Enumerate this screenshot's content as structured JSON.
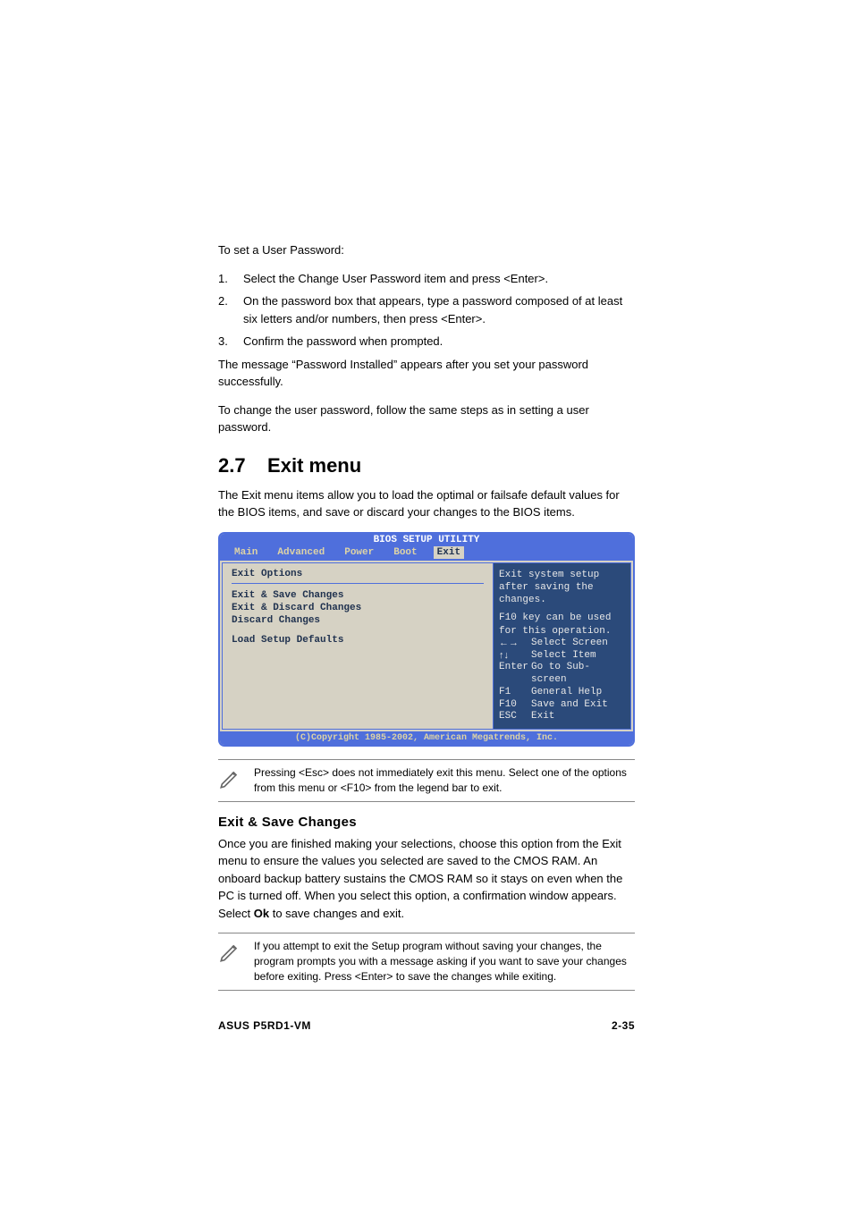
{
  "intro": {
    "set_password_head": "To set a User Password:",
    "step1_num": "1.",
    "step1": "Select the Change User Password item and press <Enter>.",
    "step2_num": "2.",
    "step2": "On the password box that appears, type a password composed of at least six letters and/or numbers, then press <Enter>.",
    "step3_num": "3.",
    "step3": "Confirm the password when prompted.",
    "installed_msg": "The message “Password Installed” appears after you set your password successfully.",
    "change_msg": "To change the user password, follow the same steps as in setting a user password."
  },
  "section": {
    "number": "2.7",
    "title": "Exit menu",
    "paragraph": "The Exit menu items allow you to load the optimal or failsafe default values for the BIOS items, and save or discard your changes to the BIOS items."
  },
  "bios": {
    "title": "BIOS SETUP UTILITY",
    "tabs": {
      "main": "Main",
      "advanced": "Advanced",
      "power": "Power",
      "boot": "Boot",
      "exit": "Exit"
    },
    "left": {
      "header": "Exit Options",
      "items": [
        "Exit & Save Changes",
        "Exit & Discard Changes",
        "Discard Changes",
        "Load Setup Defaults"
      ]
    },
    "help": {
      "line1": "Exit system setup after saving the changes.",
      "line2": "F10 key can be used for this operation."
    },
    "legend": [
      {
        "key": "←→",
        "label": "Select Screen"
      },
      {
        "key": "↑↓",
        "label": "Select Item"
      },
      {
        "key": "Enter",
        "label": "Go to Sub-screen"
      },
      {
        "key": "F1",
        "label": "General Help"
      },
      {
        "key": "F10",
        "label": "Save and Exit"
      },
      {
        "key": "ESC",
        "label": "Exit"
      }
    ],
    "copyright": "(C)Copyright 1985-2002, American Megatrends, Inc."
  },
  "note1": "Pressing <Esc> does not immediately exit this menu. Select one of the options from this menu or <F10> from the legend bar to exit.",
  "exit_save": {
    "heading": "Exit & Save Changes",
    "para_a": "Once you are finished making your selections, choose this option from the Exit menu to ensure the values you selected are saved to the CMOS RAM. An onboard backup battery sustains the CMOS RAM so it stays on even when the PC is turned off. When you select this option, a confirmation window appears. Select ",
    "ok": "Ok",
    "para_b": " to save changes and exit."
  },
  "note2": " If you attempt to exit the Setup program without saving your changes, the program prompts you with a message asking if you want to save your changes before exiting. Press <Enter>  to save the  changes while exiting.",
  "footer": {
    "left": "ASUS P5RD1-VM",
    "right": "2-35"
  }
}
